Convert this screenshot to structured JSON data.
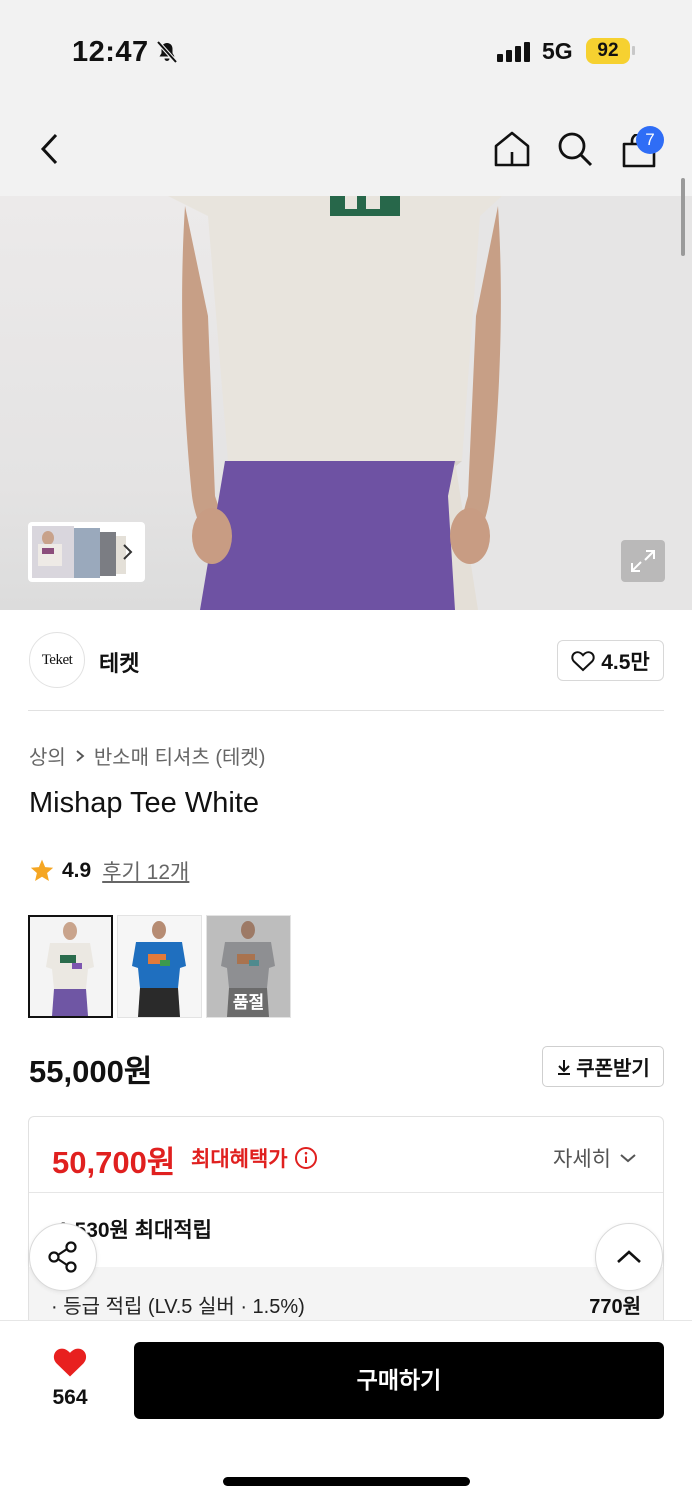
{
  "status_bar": {
    "time": "12:47",
    "network": "5G",
    "battery": "92"
  },
  "nav": {
    "cart_count": "7"
  },
  "brand": {
    "logo_text": "Teket",
    "name": "테켓",
    "likes": "4.5만"
  },
  "breadcrumb": {
    "category": "상의",
    "subcategory": "반소매 티셔츠 (테켓)"
  },
  "product": {
    "title": "Mishap Tee White",
    "rating": "4.9",
    "reviews": "후기 12개",
    "price": "55,000원",
    "coupon_label": "쿠폰받기"
  },
  "variants": [
    {
      "color": "white",
      "selected": true,
      "badge": ""
    },
    {
      "color": "blue",
      "selected": false,
      "badge": ""
    },
    {
      "color": "gray",
      "selected": false,
      "badge": "품절"
    }
  ],
  "benefit": {
    "sale_price": "50,700원",
    "sale_label": "최대혜택가",
    "detail_label": "자세히",
    "reward": "1,530원 최대적립",
    "grade_label": "· 등급 적립 (LV.5 실버 · 1.5%)",
    "grade_amount": "770원"
  },
  "bottom": {
    "wish_count": "564",
    "buy_label": "구매하기"
  },
  "colors": {
    "accent_red": "#e0201f",
    "badge_blue": "#2f6df6",
    "battery_yellow": "#f6d130"
  }
}
